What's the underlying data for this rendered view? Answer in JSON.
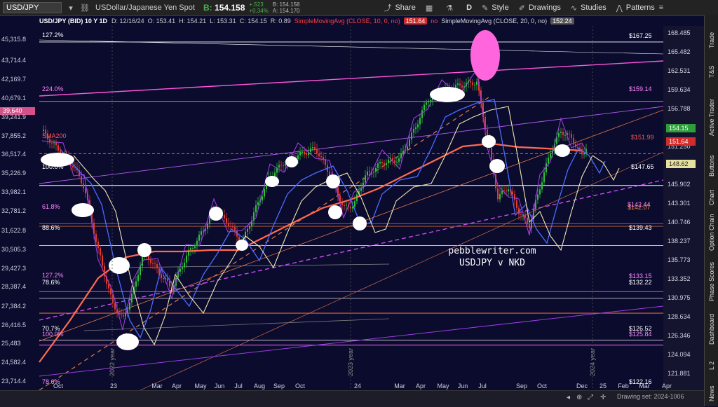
{
  "toolbar": {
    "symbol": "USD/JPY",
    "description": "USDollar/Japanese Yen Spot",
    "bid_label": "B:",
    "bid_value": "154.158",
    "change": "+.523",
    "change_pct": "+0.34%",
    "bid_small": "B: 154.158",
    "ask_small": "A: 154.170",
    "share": "Share",
    "period": "D",
    "style": "Style",
    "drawings": "Drawings",
    "studies": "Studies",
    "patterns": "Patterns"
  },
  "infobar": {
    "symbol": "USD/JPY (BID) 10 Y 1D",
    "date": "D: 12/16/24",
    "open": "O: 153.41",
    "high": "H: 154.21",
    "low": "L: 153.31",
    "close": "C: 154.15",
    "range": "R: 0.89",
    "sma10": "SimpleMovingAvg (CLOSE, 10, 0, no)",
    "sma10_val": "151.64",
    "sma10_extra": "no",
    "sma20": "SimpleMovingAvg (CLOSE, 20, 0, no)",
    "sma20_val": "152.24"
  },
  "chart_data": {
    "type": "candlestick",
    "watermark": [
      "pebblewriter.com",
      "USDJPY v NKD"
    ],
    "left_axis": [
      "45,315.8",
      "43,714.4",
      "42,169.7",
      "40,679.1",
      "39,640",
      "39,241.9",
      "37,855.2",
      "36,517.4",
      "35,226.9",
      "33,982.1",
      "32,781.2",
      "31,622.8",
      "30,505.3",
      "29,427.3",
      "28,387.4",
      "27,384.2",
      "26,416.5",
      "25,483",
      "24,582.4",
      "23,714.4"
    ],
    "right_axis": [
      "168.485",
      "165.482",
      "162.531",
      "159.634",
      "156.788",
      "153.992",
      "151.250",
      "148.557",
      "145.902",
      "143.301",
      "140.746",
      "138.237",
      "135.773",
      "133.352",
      "130.975",
      "128.634",
      "126.346",
      "124.094",
      "121.881"
    ],
    "x_labels": [
      "Oct",
      "23",
      "Mar",
      "Apr",
      "May",
      "Jun",
      "Jul",
      "Aug",
      "Sep",
      "Oct",
      "24",
      "Mar",
      "Apr",
      "May",
      "Jun",
      "Jul",
      "Sep",
      "Oct",
      "Dec",
      "25",
      "Feb",
      "Mar",
      "Apr"
    ],
    "year_labels": [
      "2022 year",
      "2023 year",
      "2024 year"
    ],
    "left_level_labels": [
      "127.2%",
      "224.0%",
      "SMA200",
      "100.0%",
      "61.8%",
      "88.6%",
      "127.2%",
      "78.6%",
      "70.7%",
      "100.0%",
      "78.6%"
    ],
    "right_level_labels": [
      "$167.25",
      "$159.14",
      "$151.99",
      "$147.65",
      "$142.44",
      "$142.07",
      "$139.43",
      "$133.15",
      "$132.22",
      "$126.52",
      "$125.84",
      "$122.16"
    ],
    "price_tags": [
      {
        "label": "154.15",
        "color": "#2e9e3a"
      },
      {
        "label": "151.64",
        "color": "#d22b2b"
      },
      {
        "label": "148.62",
        "color": "#e6e0a0"
      }
    ],
    "left_tag": "39,640",
    "colors": {
      "background": "#0b0b2e",
      "up": "#2fbf3a",
      "down": "#e23b2e",
      "sma200": "#ff6a4f",
      "sma_blue": "#4a6cff",
      "sma_cream": "#f0e6b0",
      "nikkei": "#a340e8",
      "fib_line": "#ffffff",
      "channel": "#e0784a",
      "magenta": "#ff55dd"
    }
  },
  "sidebar": {
    "tabs": [
      "Trade",
      "T&S",
      "Active Trader",
      "Buttons",
      "Chart",
      "Option Chain",
      "Phase Scores",
      "Dashboard",
      "L 2",
      "News"
    ]
  },
  "bottom": {
    "drawing_set": "Drawing set: 2024-1006"
  }
}
